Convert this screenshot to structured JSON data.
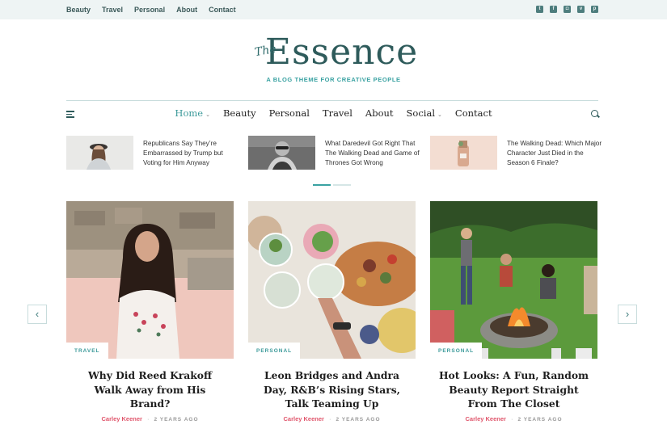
{
  "top_nav": [
    "Beauty",
    "Travel",
    "Personal",
    "About",
    "Contact"
  ],
  "social_icons": [
    "twitter-icon",
    "facebook-icon",
    "instagram-icon",
    "vimeo-icon",
    "pinterest-icon"
  ],
  "logo": {
    "the": "The",
    "word": "Essence",
    "tagline": "A BLOG THEME FOR CREATIVE PEOPLE"
  },
  "main_nav": {
    "home": "Home",
    "beauty": "Beauty",
    "personal": "Personal",
    "travel": "Travel",
    "about": "About",
    "social": "Social",
    "contact": "Contact"
  },
  "mini_posts": [
    {
      "title": "Republicans Say They’re Embarrassed by Trump but Voting for Him Anyway"
    },
    {
      "title": "What Daredevil Got Right That The Walking Dead and Game of Thrones Got Wrong"
    },
    {
      "title": "The Walking Dead: Which Major Character Just Died in the Season 6 Finale?"
    }
  ],
  "cards": [
    {
      "category": "TRAVEL",
      "title": "Why Did Reed Krakoff Walk Away from His Brand?",
      "author": "Carley Keener",
      "ago": "2 YEARS AGO"
    },
    {
      "category": "PERSONAL",
      "title": "Leon Bridges and Andra Day, R&B’s Rising Stars, Talk Teaming Up",
      "author": "Carley Keener",
      "ago": "2 YEARS AGO"
    },
    {
      "category": "PERSONAL",
      "title": "Hot Looks: A Fun, Random Beauty Report Straight From The Closet",
      "author": "Carley Keener",
      "ago": "2 YEARS AGO"
    }
  ],
  "arrows": {
    "prev": "‹",
    "next": "›"
  },
  "colors": {
    "accent": "#3aa2a2",
    "author": "#e0566c",
    "topbar": "#eef4f4"
  }
}
